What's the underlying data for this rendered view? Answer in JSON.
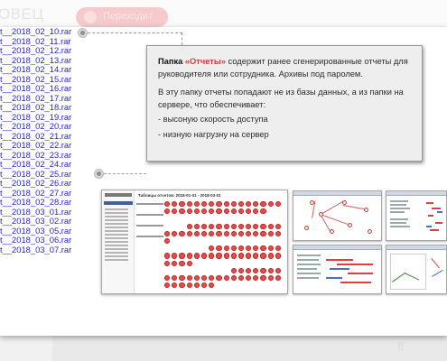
{
  "background": {
    "title": "ОВЕЦ",
    "pill_label": "Переходит",
    "footer_text": "ff"
  },
  "files": [
    "t__2018_02_10.rar",
    "t__2018_02_11.rar",
    "t__2018_02_12.rar",
    "t__2018_02_13.rar",
    "t__2018_02_14.rar",
    "t__2018_02_15.rar",
    "t__2018_02_16.rar",
    "t__2018_02_17.rar",
    "t__2018_02_18.rar",
    "t__2018_02_19.rar",
    "t__2018_02_20.rar",
    "t__2018_02_21.rar",
    "t__2018_02_22.rar",
    "t__2018_02_23.rar",
    "t__2018_02_24.rar",
    "t__2018_02_25.rar",
    "t__2018_02_26.rar",
    "t__2018_02_27.rar",
    "t__2018_02_28.rar",
    "t__2018_03_01.rar",
    "t__2018_03_02.rar",
    "t__2018_03_05.rar",
    "t__2018_03_06.rar",
    "t__2018_03_07.rar"
  ],
  "callout": {
    "p1_bold": "Папка",
    "p1_accent": "«Отчеты»",
    "p1_rest": " содержит ранее сгенерированные отчеты для руководителя или сотрудника. Архивы под паролем.",
    "p2": "В эту папку отчеты попадают не из базы данных, а из папки на сервере, что обеспечивает:",
    "bullet1": "- высоную скорость доступа",
    "bullet2": "- низную нагрузну на сервер"
  },
  "screenshot": {
    "title": "Таблицы отчетов: 2018-01-01 - 2018-03-01"
  },
  "colors": {
    "link": "#2626c8",
    "accent": "#d23a3a",
    "callout_bg": "#eeeeee"
  }
}
